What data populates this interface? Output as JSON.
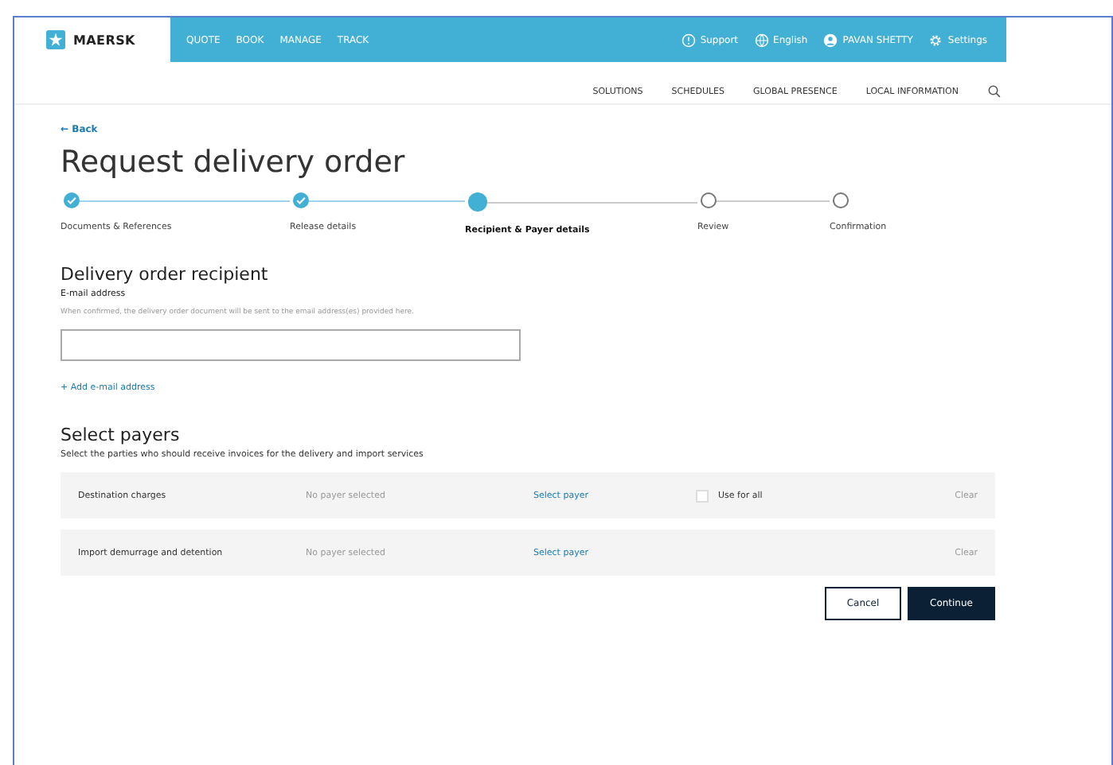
{
  "header": {
    "brand": "MAERSK",
    "nav": [
      {
        "label": "QUOTE"
      },
      {
        "label": "BOOK"
      },
      {
        "label": "MANAGE"
      },
      {
        "label": "TRACK"
      }
    ],
    "utilities": [
      {
        "kind": "support",
        "label": "Support"
      },
      {
        "kind": "language",
        "label": "English"
      },
      {
        "kind": "user",
        "label": "PAVAN SHETTY"
      },
      {
        "kind": "settings",
        "label": "Settings"
      }
    ],
    "subnav": [
      "SOLUTIONS",
      "SCHEDULES",
      "GLOBAL PRESENCE",
      "LOCAL INFORMATION"
    ]
  },
  "back": "← Back",
  "title": "Request delivery order",
  "steps": [
    {
      "label": "Documents & References",
      "completed": true,
      "selected": false
    },
    {
      "label": "Release details",
      "completed": true,
      "selected": false
    },
    {
      "label": "Recipient & Payer details",
      "completed": false,
      "selected": true
    },
    {
      "label": "Review",
      "completed": false,
      "selected": false
    },
    {
      "label": "Confirmation",
      "completed": false,
      "selected": false
    }
  ],
  "recipient": {
    "heading": "Delivery order recipient",
    "field_label": "E-mail address",
    "hint": "When confirmed, the delivery order document will be sent to the email address(es) provided here.",
    "add_link": "+ Add e-mail address"
  },
  "payers": {
    "heading": "Select payers",
    "description": "Select the parties who should receive invoices for the delivery and import services",
    "rows": [
      {
        "charge": "Destination charges",
        "payer": "No payer selected",
        "action": "Select payer",
        "use_for_all": {
          "label": "Use for all",
          "checked": false
        },
        "clear": "Clear"
      },
      {
        "charge": "Import demurrage and detention",
        "payer": "No payer selected",
        "action": "Select payer",
        "clear": "Clear"
      }
    ]
  },
  "buttons": [
    {
      "kind": "secondary",
      "label": "Cancel"
    },
    {
      "kind": "primary",
      "label": "Continue"
    }
  ]
}
